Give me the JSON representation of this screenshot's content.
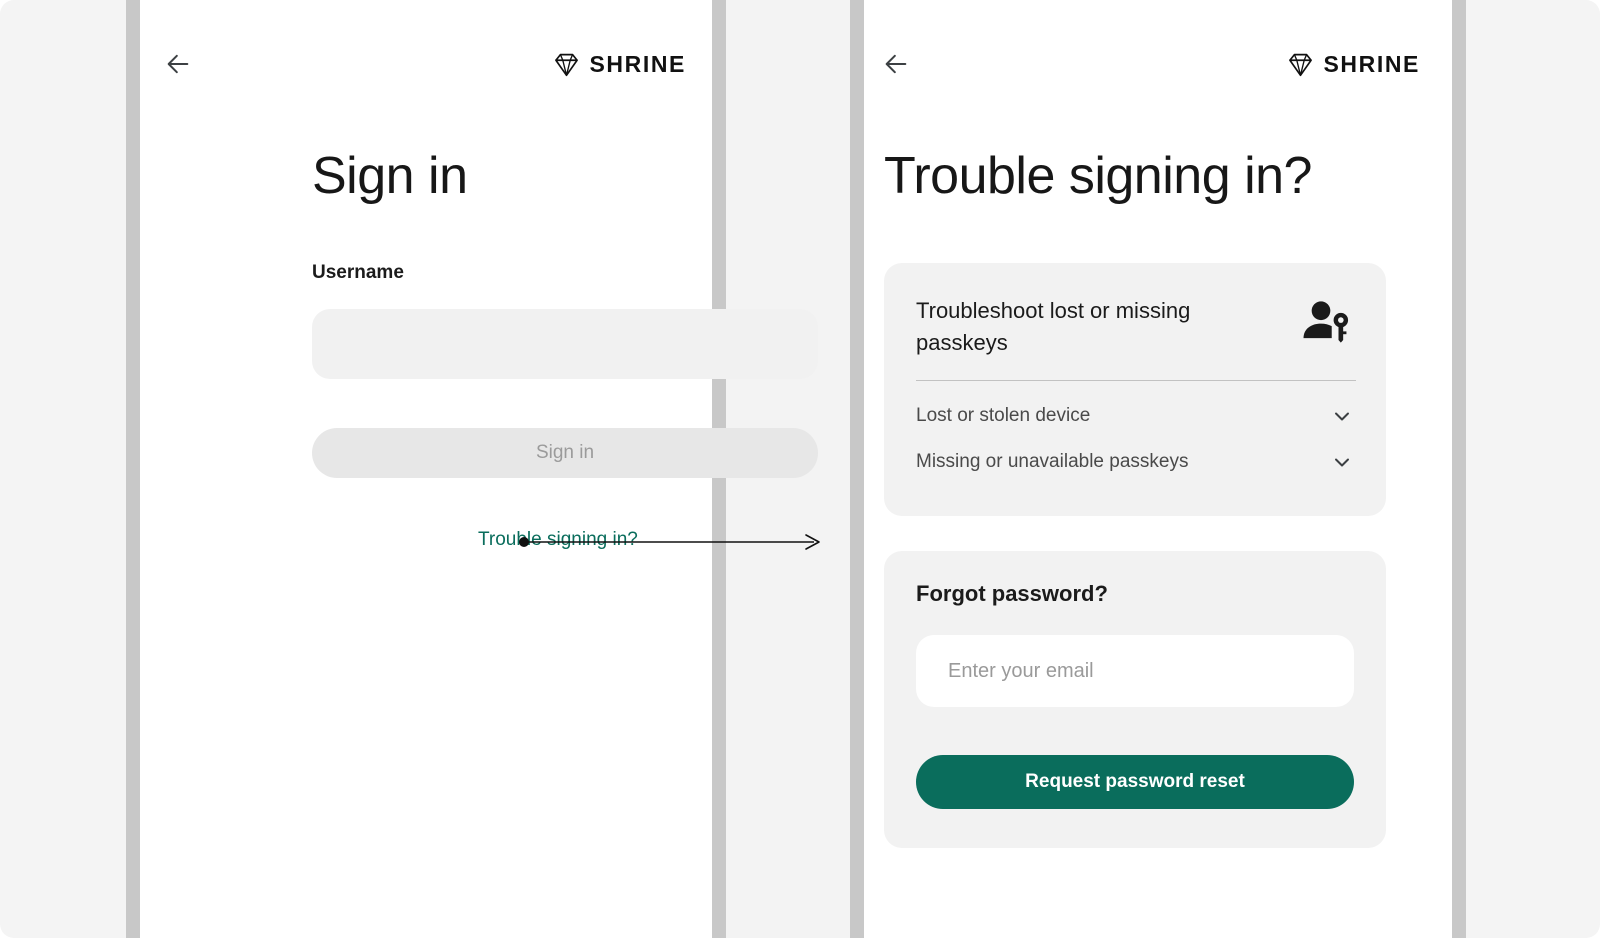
{
  "brand": {
    "name": "SHRINE",
    "logo_icon": "diamond-icon"
  },
  "colors": {
    "accent_teal": "#0a6d5c",
    "panel_bg": "#ffffff",
    "card_bg": "#f2f2f2",
    "input_bg": "#f1f1f1",
    "disabled_btn_bg": "#e7e7e7",
    "disabled_btn_text": "#9b9b9b",
    "frame_edge": "#c8c8c8",
    "page_bg": "#f4f4f4"
  },
  "left_screen": {
    "back_icon": "arrow-left-icon",
    "title": "Sign in",
    "username_label": "Username",
    "username_value": "",
    "username_placeholder": "",
    "signin_button": "Sign in",
    "trouble_link": "Trouble signing in?"
  },
  "annotation": {
    "description": "arrow from trouble signing in link to second screen"
  },
  "right_screen": {
    "back_icon": "arrow-left-icon",
    "title": "Trouble signing in?",
    "passkeys_card": {
      "title": "Troubleshoot lost or missing passkeys",
      "icon": "person-key-icon",
      "rows": [
        {
          "label": "Lost or stolen device",
          "icon": "chevron-down-icon"
        },
        {
          "label": "Missing or unavailable passkeys",
          "icon": "chevron-down-icon"
        }
      ]
    },
    "forgot_card": {
      "title": "Forgot password?",
      "email_value": "",
      "email_placeholder": "Enter your email",
      "submit_button": "Request password reset"
    }
  }
}
